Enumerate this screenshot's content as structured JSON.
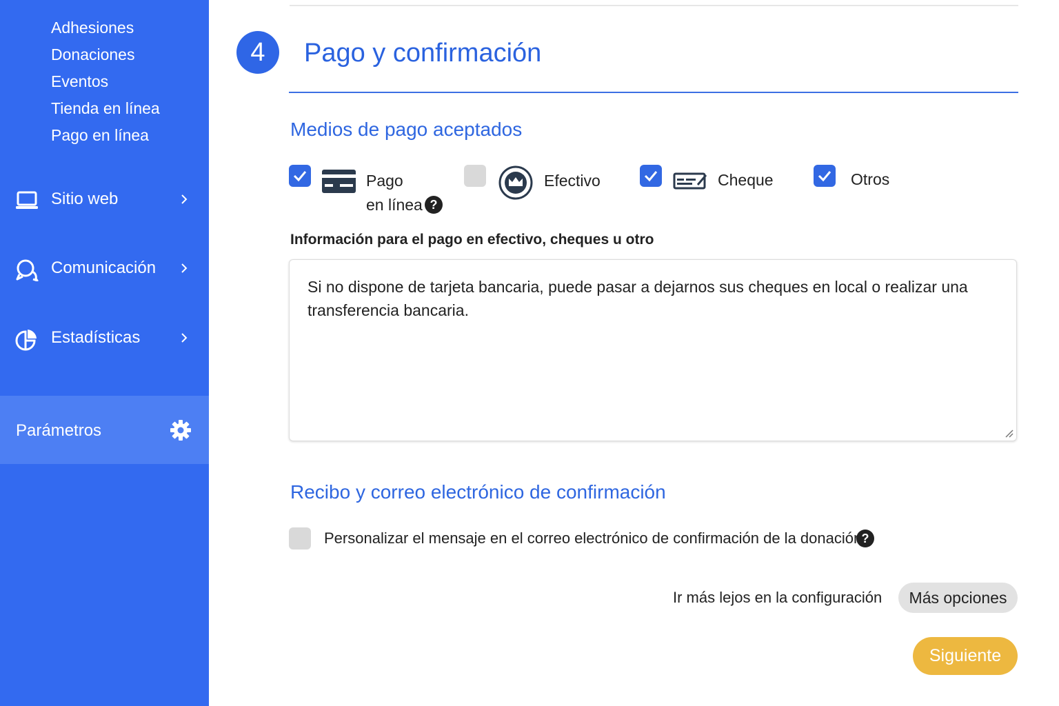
{
  "sidebar": {
    "sub_items": [
      "Adhesiones",
      "Donaciones",
      "Eventos",
      "Tienda en línea",
      "Pago en línea"
    ],
    "nav": {
      "website": "Sitio web",
      "communication": "Comunicación",
      "statistics": "Estadísticas"
    },
    "parameters": "Parámetros"
  },
  "main": {
    "step_number": "4",
    "title": "Pago y confirmación",
    "payment_section": {
      "title": "Medios de pago aceptados",
      "methods": {
        "online": {
          "label_line1": "Pago",
          "label_line2": "en línea",
          "checked": true
        },
        "cash": {
          "label": "Efectivo",
          "checked": false
        },
        "check": {
          "label": "Cheque",
          "checked": true
        },
        "other": {
          "label": "Otros",
          "checked": true
        }
      },
      "info_label": "Información para el pago en efectivo, cheques u otro",
      "info_text": "Si no dispone de tarjeta bancaria, puede pasar a dejarnos sus cheques en local o realizar una transferencia bancaria."
    },
    "receipt_section": {
      "title": "Recibo y correo electrónico de confirmación",
      "customize_label": "Personalizar el mensaje en el correo electrónico de confirmación de la donación",
      "customize_checked": false
    },
    "config_text": "Ir más lejos en la configuración",
    "more_options": "Más opciones",
    "next": "Siguiente",
    "help_glyph": "?"
  },
  "colors": {
    "sidebar": "#336af0",
    "sidebar_active": "#4d7ff3",
    "accent": "#2f66e6",
    "next_button": "#edb840"
  }
}
